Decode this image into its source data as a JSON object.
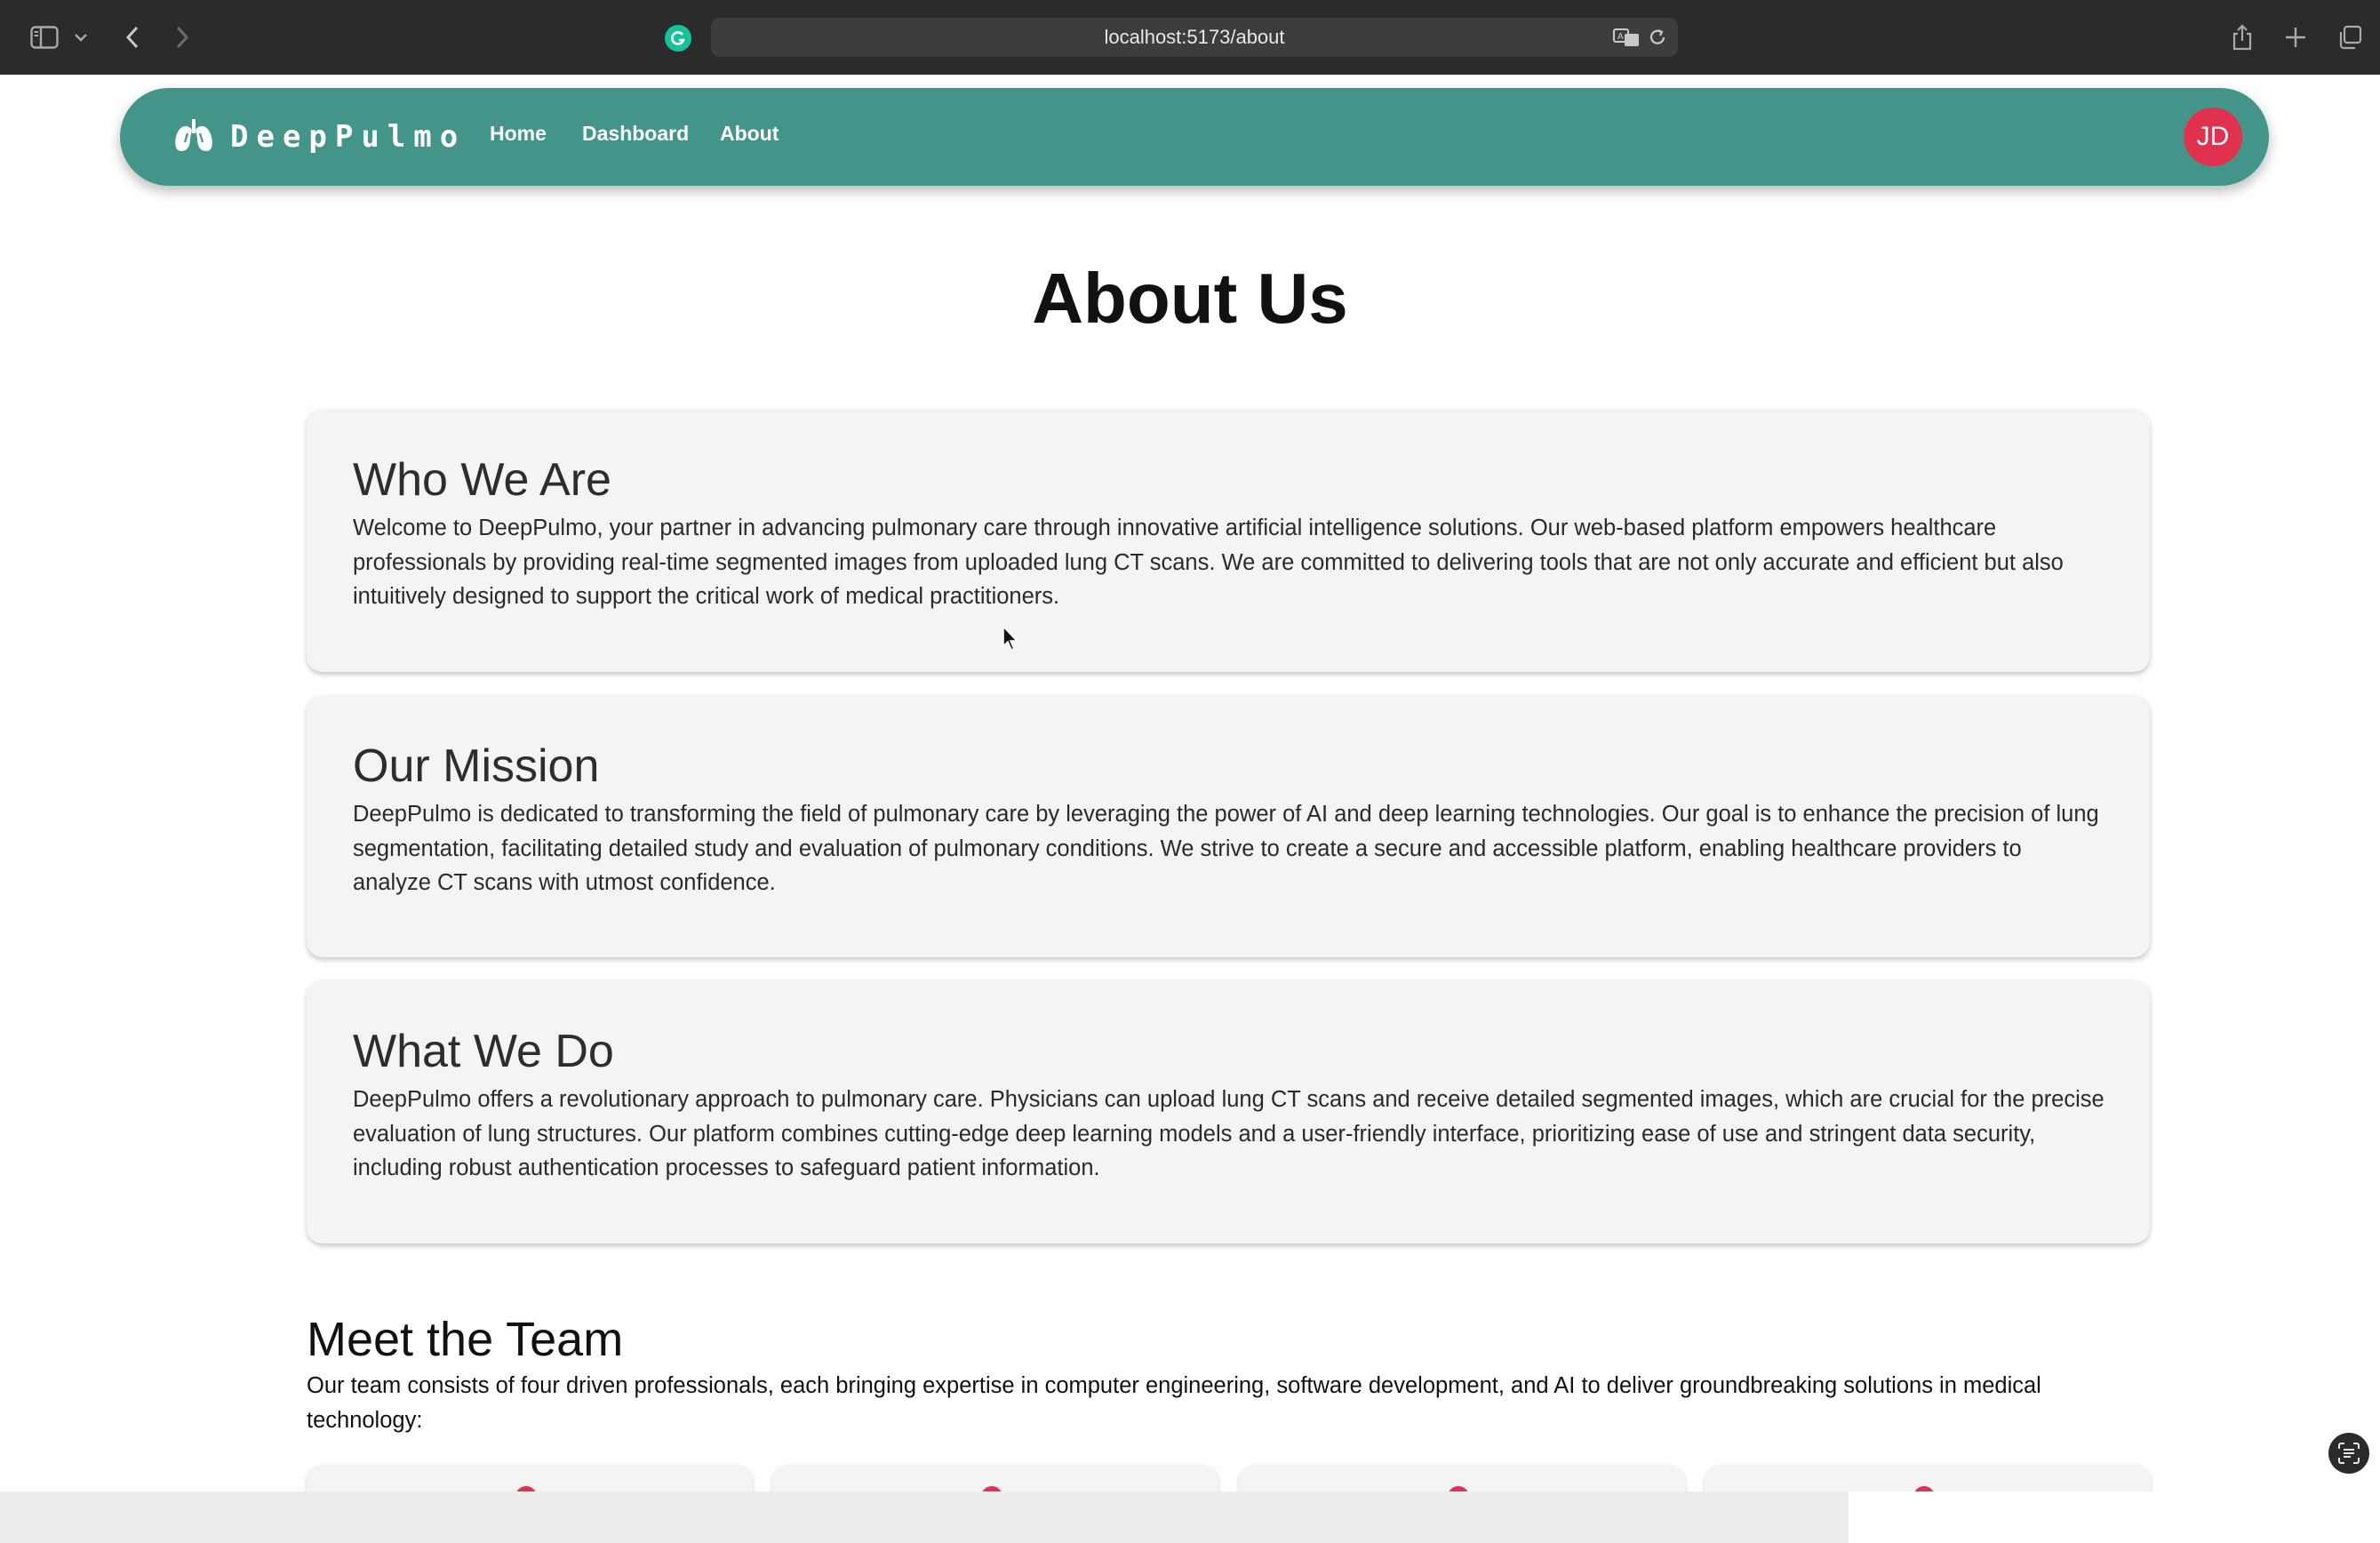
{
  "browser": {
    "url": "localhost:5173/about",
    "icons": [
      "sidebar-icon",
      "chevron-down-icon",
      "back-icon",
      "forward-icon",
      "grammarly-icon",
      "translate-icon",
      "reload-icon",
      "share-icon",
      "new-tab-icon",
      "tabs-overview-icon"
    ]
  },
  "navbar": {
    "brand": "DeepPulmo",
    "links": [
      "Home",
      "Dashboard",
      "About"
    ],
    "avatar_initials": "JD",
    "bg_color": "#43958a",
    "avatar_color": "#e0314f"
  },
  "page": {
    "title": "About Us"
  },
  "sections": [
    {
      "heading": "Who We Are",
      "body": "Welcome to DeepPulmo, your partner in advancing pulmonary care through innovative artificial intelligence solutions. Our web-based platform empowers healthcare professionals by providing real-time segmented images from uploaded lung CT scans. We are committed to delivering tools that are not only accurate and efficient but also intuitively designed to support the critical work of medical practitioners."
    },
    {
      "heading": "Our Mission",
      "body": "DeepPulmo is dedicated to transforming the field of pulmonary care by leveraging the power of AI and deep learning technologies. Our goal is to enhance the precision of lung segmentation, facilitating detailed study and evaluation of pulmonary conditions. We strive to create a secure and accessible platform, enabling healthcare providers to analyze CT scans with utmost confidence."
    },
    {
      "heading": "What We Do",
      "body": "DeepPulmo offers a revolutionary approach to pulmonary care. Physicians can upload lung CT scans and receive detailed segmented images, which are crucial for the precise evaluation of lung structures. Our platform combines cutting-edge deep learning models and a user-friendly interface, prioritizing ease of use and stringent data security, including robust authentication processes to safeguard patient information."
    }
  ],
  "team": {
    "heading": "Meet the Team",
    "intro": "Our team consists of four driven professionals, each bringing expertise in computer engineering, software development, and AI to deliver groundbreaking solutions in medical technology:"
  }
}
